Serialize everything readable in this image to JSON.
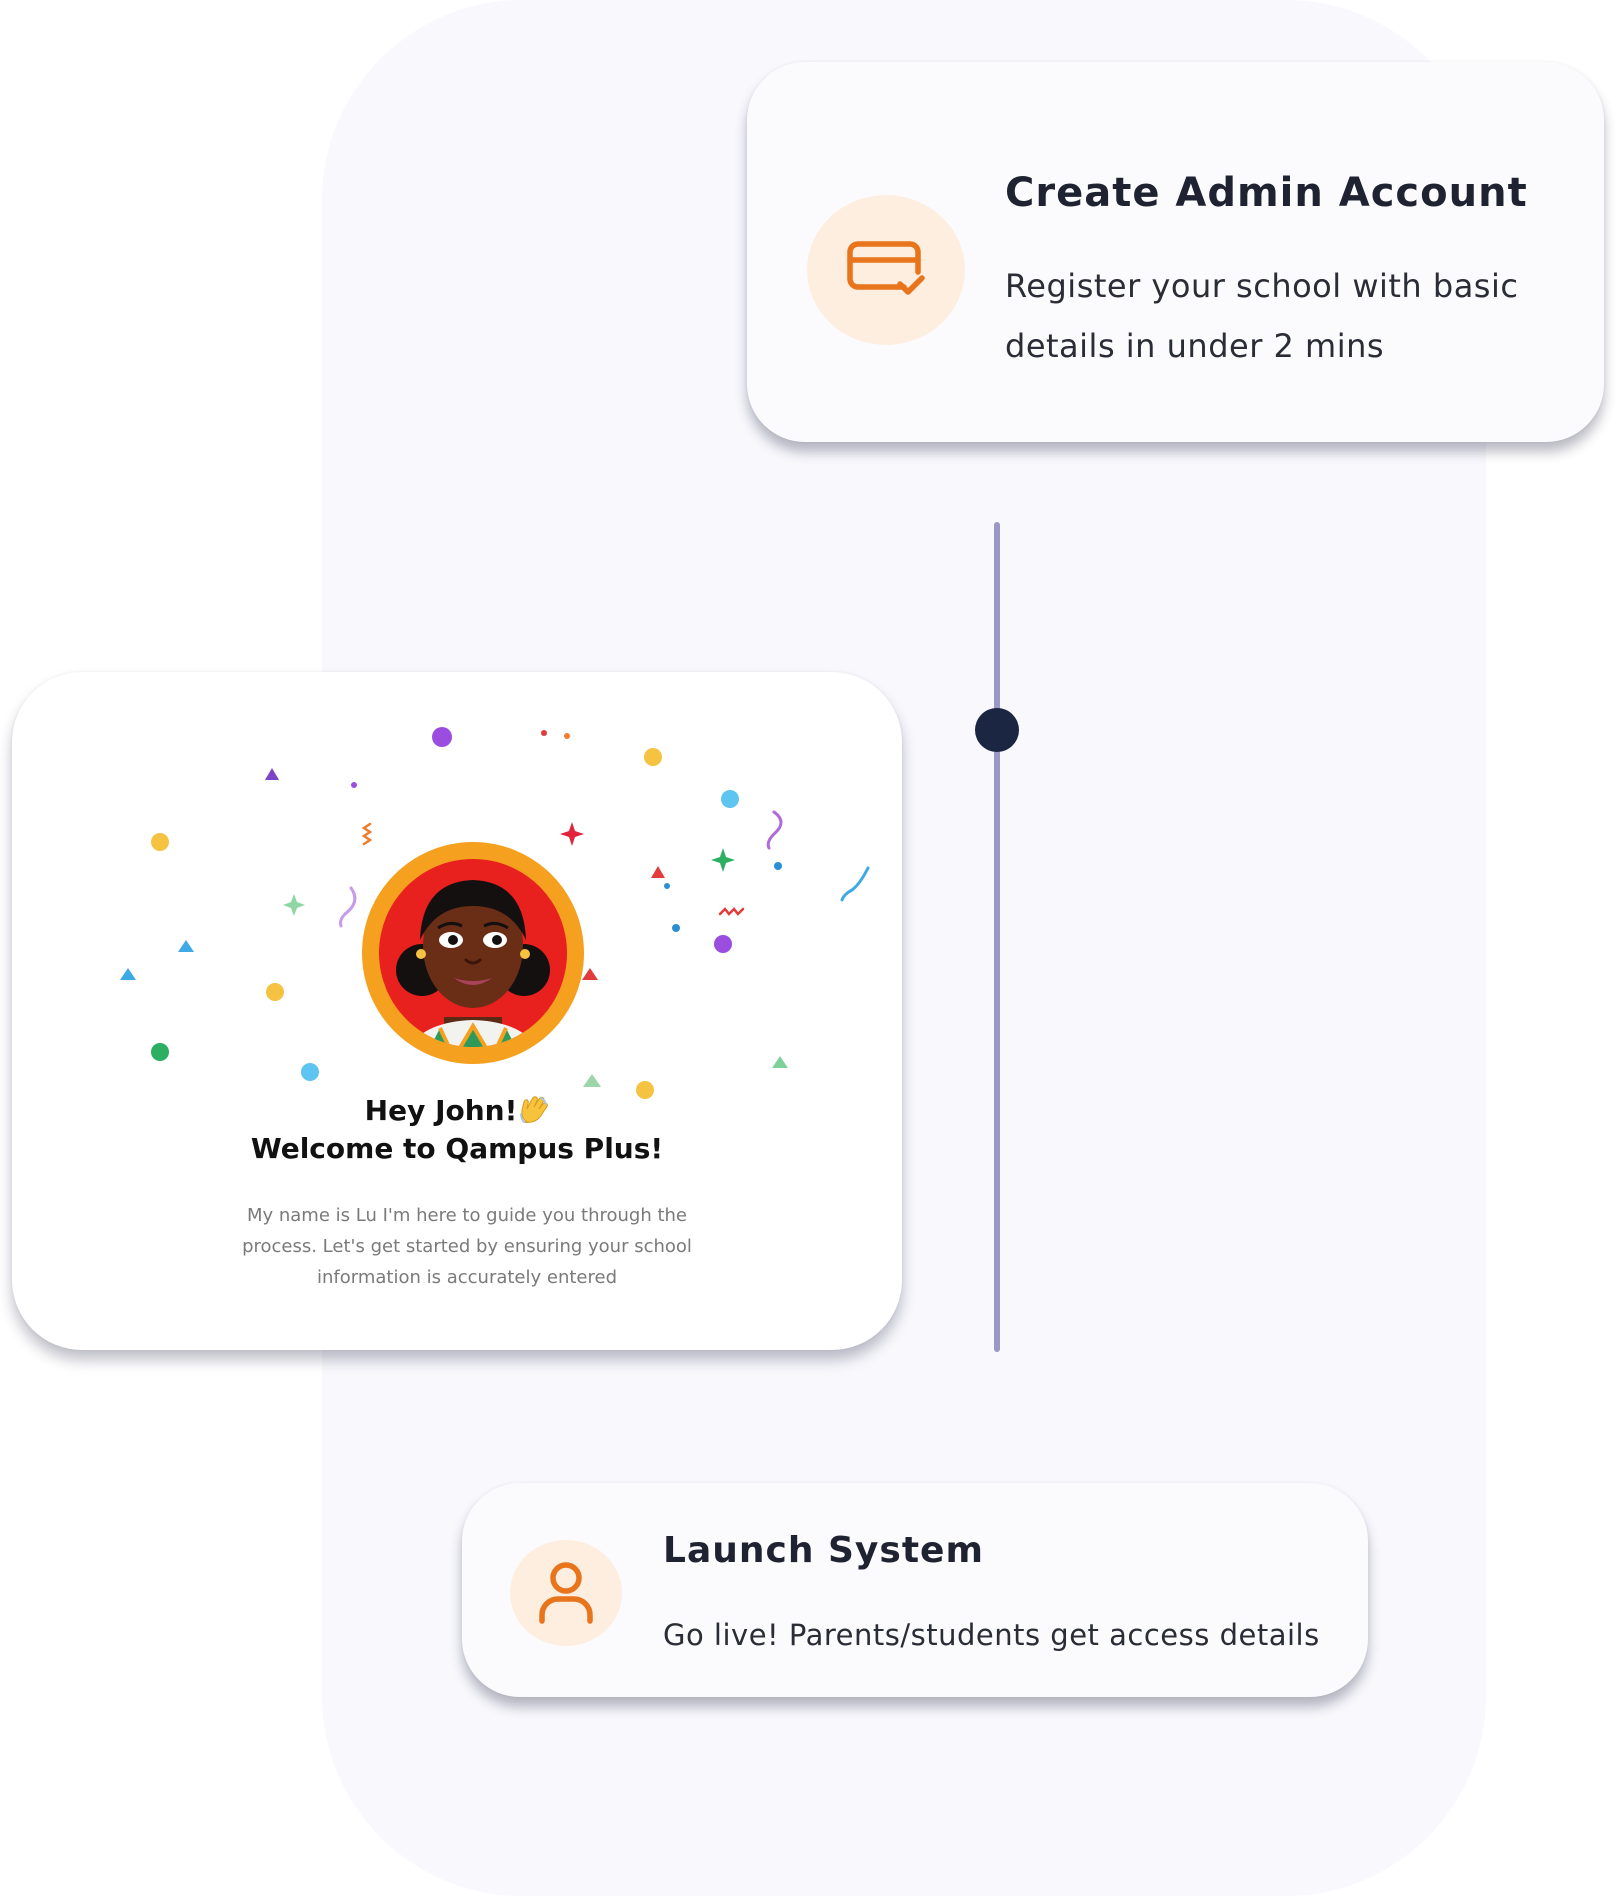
{
  "steps": [
    {
      "id": "create-admin",
      "title": "Create Admin Account",
      "description": "Register your school with basic details in under 2 mins",
      "icon": "card-check-icon"
    },
    {
      "id": "launch-system",
      "title": "Launch System",
      "description": "Go live! Parents/students get access details",
      "icon": "user-icon"
    }
  ],
  "welcome": {
    "greeting": "Hey John!",
    "title": "Welcome to Qampus Plus!",
    "message": "My name is Lu I'm here to guide you through the process. Let's get started by ensuring your school information is accurately entered",
    "greeting_icon": "waving-hand-icon"
  },
  "colors": {
    "accent": "#e8741c",
    "icon_bg": "#fdeee0",
    "panel_bg": "#f8f8fd",
    "timeline": "#9b97c6",
    "timeline_dot": "#1b2642"
  }
}
